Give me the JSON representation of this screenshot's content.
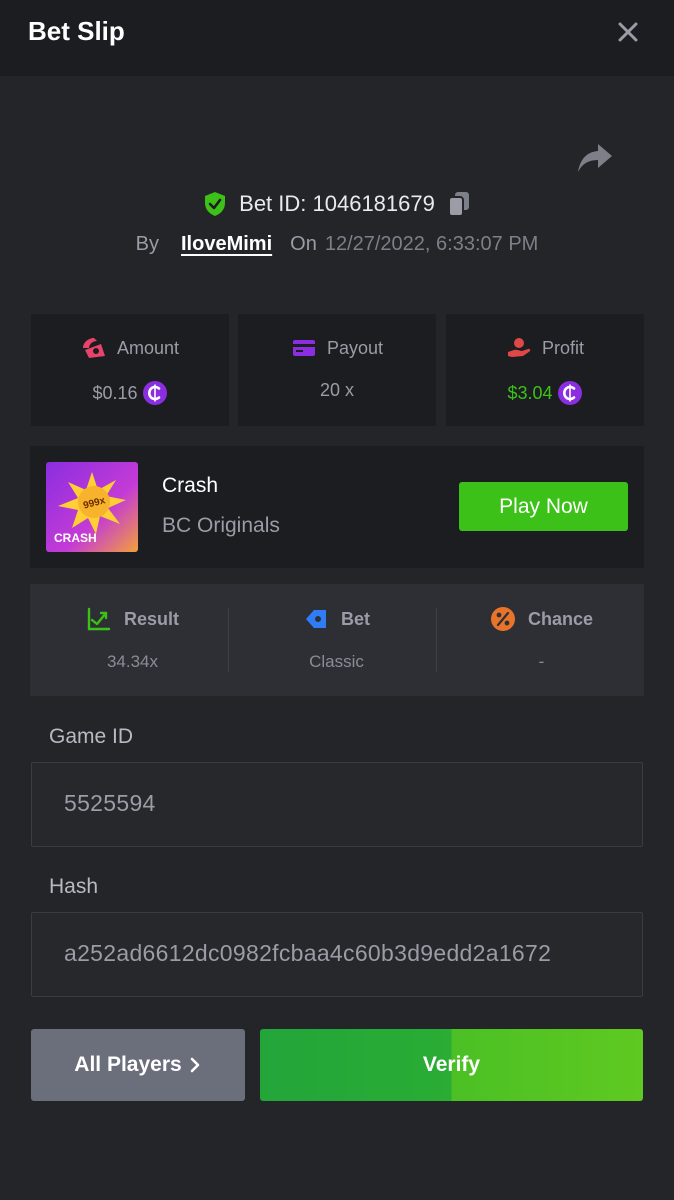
{
  "header": {
    "title": "Bet Slip"
  },
  "bet": {
    "id_text": "Bet ID: 1046181679",
    "by_label": "By",
    "username": "IloveMimi",
    "on_label": "On",
    "date": "12/27/2022, 6:33:07 PM"
  },
  "stats": [
    {
      "label": "Amount",
      "value": "$0.16",
      "icon": "amount-icon",
      "value_color": "#9a9ca6"
    },
    {
      "label": "Payout",
      "value": "20 x",
      "icon": "payout-icon",
      "value_color": "#9a9ca6"
    },
    {
      "label": "Profit",
      "value": "$3.04",
      "icon": "profit-icon",
      "value_color": "#3bc117"
    }
  ],
  "game": {
    "name": "Crash",
    "provider": "BC Originals",
    "thumb_text": "CRASH",
    "thumb_badge": "999x",
    "play_label": "Play Now"
  },
  "result": [
    {
      "label": "Result",
      "value": "34.34x",
      "icon": "result-chart-icon"
    },
    {
      "label": "Bet",
      "value": "Classic",
      "icon": "bet-ticket-icon"
    },
    {
      "label": "Chance",
      "value": "-",
      "icon": "percent-icon"
    }
  ],
  "fields": {
    "game_id_label": "Game ID",
    "game_id_value": "5525594",
    "hash_label": "Hash",
    "hash_value": "a252ad6612dc0982fcbaa4c60b3d9edd2a1672"
  },
  "actions": {
    "players_label": "All Players",
    "verify_label": "Verify"
  },
  "colors": {
    "accent_green": "#3bc117",
    "background": "#232529",
    "card": "#1c1d21",
    "coin_purple": "#8a2ee0"
  }
}
